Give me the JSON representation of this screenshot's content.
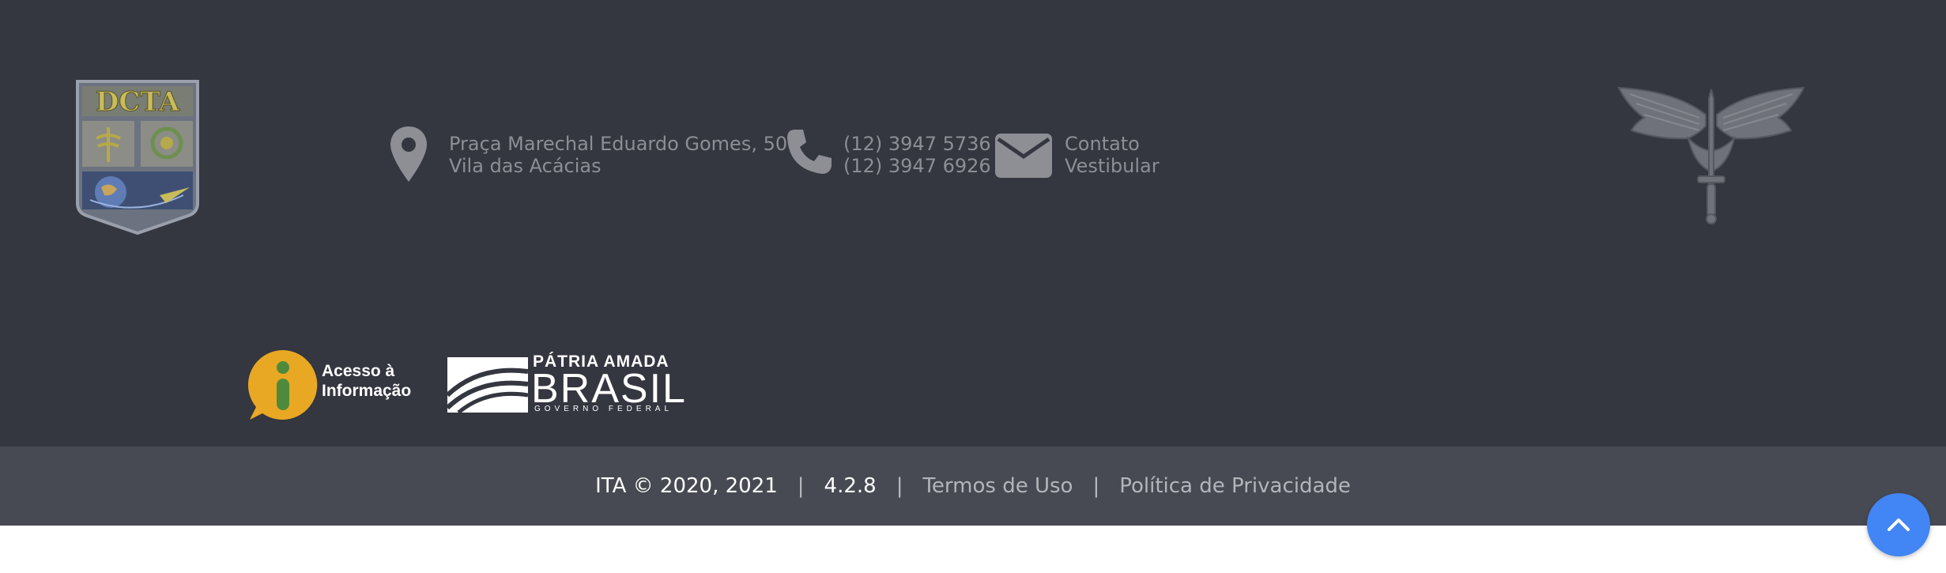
{
  "colors": {
    "footer_bg": "#343640",
    "bottom_bar_bg": "#484a53",
    "muted_text": "#8d8f95",
    "link_text": "#b3b5bb",
    "accent_blue": "#4285f4",
    "acesso_yellow": "#e8a824",
    "acesso_green": "#4f8a3c"
  },
  "logos": {
    "dcta_text": "DCTA",
    "acesso_line1": "Acesso à",
    "acesso_line2": "Informação",
    "patria_top": "PÁTRIA AMADA",
    "patria_main": "BRASIL",
    "patria_sub": "GOVERNO FEDERAL"
  },
  "contact": {
    "address_icon": "map-marker-icon",
    "address_line1": "Praça Marechal Eduardo Gomes, 50",
    "address_line2": "Vila das Acácias",
    "phone_icon": "phone-icon",
    "phone1": "(12) 3947 5736",
    "phone2": "(12) 3947 6926",
    "mail_icon": "envelope-icon",
    "link_contato": "Contato",
    "link_vestibular": "Vestibular"
  },
  "bottom_bar": {
    "copyright": "ITA © 2020, 2021",
    "separator": "|",
    "version": "4.2.8",
    "terms_link": "Termos de Uso",
    "privacy_link": "Política de Privacidade"
  },
  "back_to_top": {
    "icon": "chevron-up-icon"
  }
}
